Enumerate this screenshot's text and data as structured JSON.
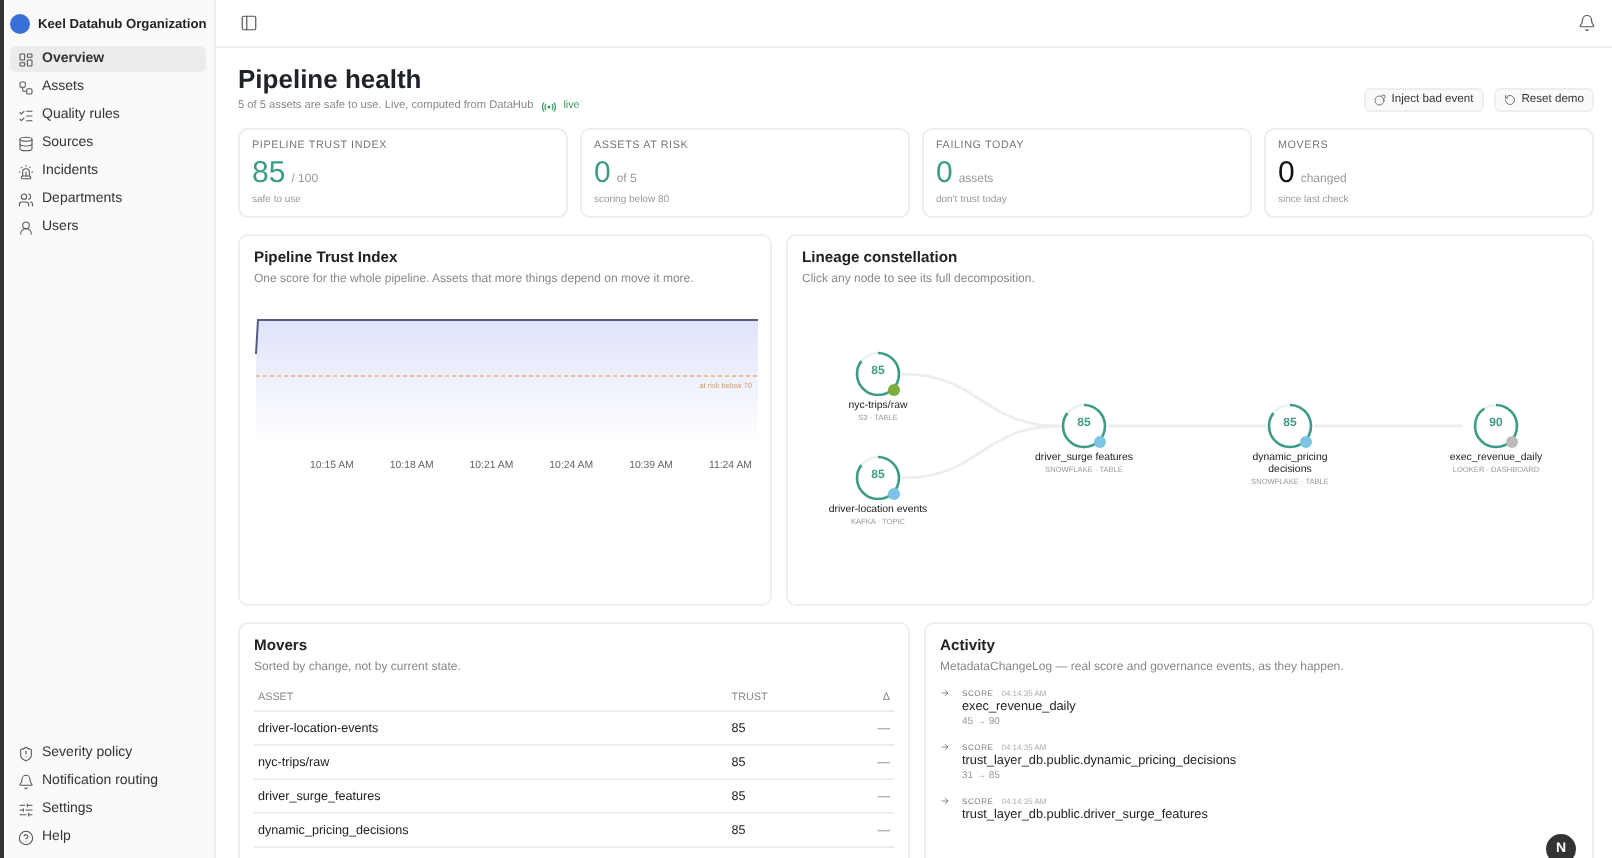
{
  "org": {
    "name": "Keel Datahub Organization"
  },
  "nav": [
    {
      "label": "Overview",
      "selected": true
    },
    {
      "label": "Assets",
      "selected": false
    },
    {
      "label": "Quality rules",
      "selected": false
    },
    {
      "label": "Sources",
      "selected": false
    },
    {
      "label": "Incidents",
      "selected": false
    },
    {
      "label": "Departments",
      "selected": false
    },
    {
      "label": "Users",
      "selected": false
    }
  ],
  "nav_bottom": [
    {
      "label": "Severity policy"
    },
    {
      "label": "Notification routing"
    },
    {
      "label": "Settings"
    },
    {
      "label": "Help"
    }
  ],
  "page": {
    "title": "Pipeline health",
    "subtitle": "5 of 5 assets are safe to use. Live, computed from DataHub",
    "live_badge": "live",
    "actions": [
      "Inject bad event",
      "Reset demo"
    ]
  },
  "kpis": [
    {
      "label": "PIPELINE TRUST INDEX",
      "value": "85",
      "unit": "/ 100",
      "note": "safe to use",
      "color": "#3d9c86"
    },
    {
      "label": "ASSETS AT RISK",
      "value": "0",
      "unit": "of 5",
      "note": "scoring below 80",
      "color": "#3d9c86"
    },
    {
      "label": "FAILING TODAY",
      "value": "0",
      "unit": "assets",
      "note": "don't trust today",
      "color": "#3d9c86"
    },
    {
      "label": "MOVERS",
      "value": "0",
      "unit": "changed",
      "note": "since last check",
      "color": "#111111"
    }
  ],
  "trust_panel": {
    "title": "Pipeline Trust Index",
    "subtitle": "One score for the whole pipeline. Assets that more things depend on move it more.",
    "threshold_label": "at risk below 70",
    "x_labels": [
      "10:15 AM",
      "10:18 AM",
      "10:21 AM",
      "10:24 AM",
      "10:39 AM",
      "11:24 AM"
    ]
  },
  "lineage": {
    "title": "Lineage constellation",
    "subtitle": "Click any node to see its full decomposition.",
    "nodes": [
      {
        "score": "85",
        "name": "nyc-trips/raw",
        "meta": "S3 · TABLE"
      },
      {
        "score": "85",
        "name": "driver-location events",
        "meta": "KAFKA · TOPIC"
      },
      {
        "score": "85",
        "name": "driver_surge features",
        "meta": "SNOWFLAKE · TABLE"
      },
      {
        "score": "85",
        "name": "dynamic_pricing decisions",
        "meta": "SNOWFLAKE · TABLE"
      },
      {
        "score": "90",
        "name": "exec_revenue_daily",
        "meta": "LOOKER · DASHBOARD"
      }
    ]
  },
  "movers": {
    "title": "Movers",
    "subtitle": "Sorted by change, not by current state.",
    "columns": [
      "ASSET",
      "TRUST",
      "Δ"
    ],
    "rows": [
      [
        "driver-location-events",
        "85",
        "—"
      ],
      [
        "nyc-trips/raw",
        "85",
        "—"
      ],
      [
        "driver_surge_features",
        "85",
        "—"
      ],
      [
        "dynamic_pricing_decisions",
        "85",
        "—"
      ]
    ]
  },
  "activity": {
    "title": "Activity",
    "subtitle": "MetadataChangeLog — real score and governance events, as they happen.",
    "events": [
      {
        "kind": "SCORE",
        "time": "04:14:35 AM",
        "name": "exec_revenue_daily",
        "change": "45 → 90"
      },
      {
        "kind": "SCORE",
        "time": "04:14:35 AM",
        "name": "trust_layer_db.public.dynamic_pricing_decisions",
        "change": "31 → 85"
      },
      {
        "kind": "SCORE",
        "time": "04:14:35 AM",
        "name": "trust_layer_db.public.driver_surge_features"
      }
    ]
  },
  "fab": {
    "label": "N"
  }
}
